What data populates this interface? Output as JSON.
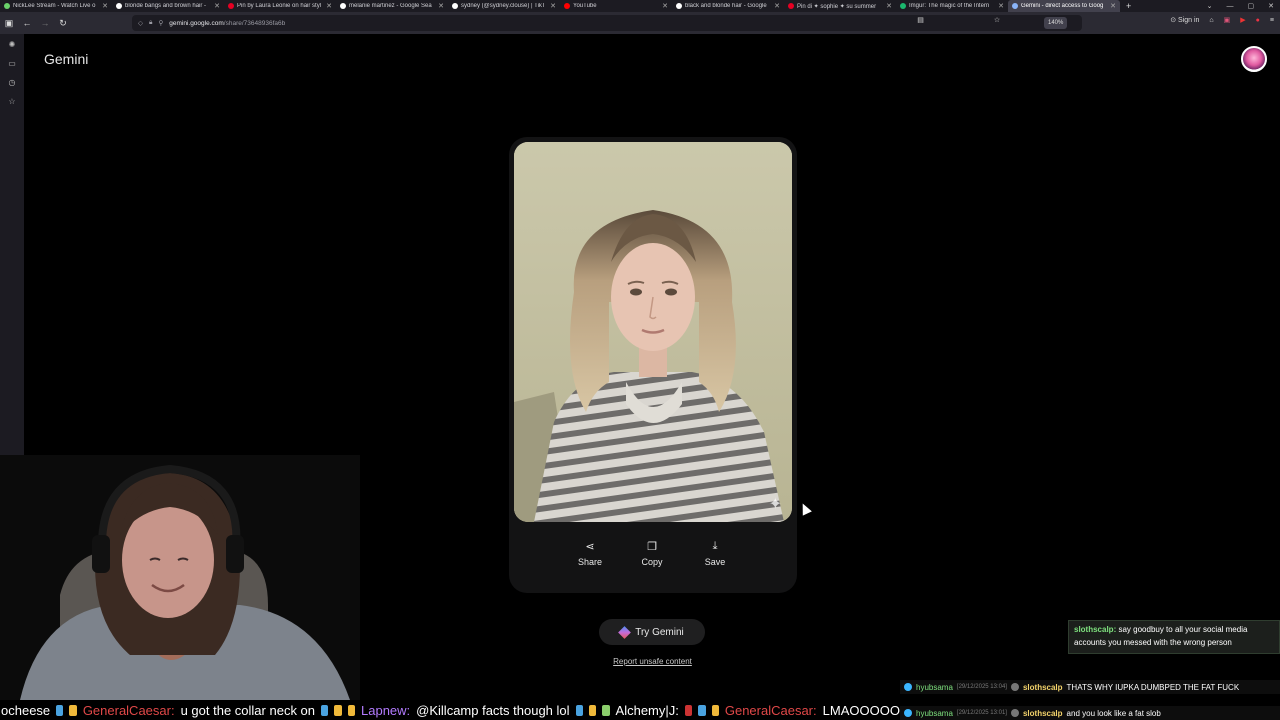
{
  "browser": {
    "tabs": [
      {
        "title": "NickLee Stream - Watch Live o",
        "favicon_color": "#6ad16a"
      },
      {
        "title": "blonde bangs and brown hair -",
        "favicon_color": "#ffffff"
      },
      {
        "title": "Pin by Laura Leonie on hair styl",
        "favicon_color": "#e60023"
      },
      {
        "title": "melanie martinez - Google Sea",
        "favicon_color": "#ffffff"
      },
      {
        "title": "sydney (@sydney.clouse) | TikT",
        "favicon_color": "#ffffff"
      },
      {
        "title": "YouTube",
        "favicon_color": "#ff0000"
      },
      {
        "title": "black and blonde hair - Google",
        "favicon_color": "#ffffff"
      },
      {
        "title": "Pin di ✦ sophie ✦ su summer",
        "favicon_color": "#e60023"
      },
      {
        "title": "Imgur: The magic of the Intern",
        "favicon_color": "#1bb76e"
      },
      {
        "title": "Gemini - direct access to Goog",
        "favicon_color": "#8ab4f8"
      }
    ],
    "url_domain": "gemini.google.com",
    "url_path": "/share/73648936fa6b",
    "zoom": "140%",
    "sign_in": "Sign in"
  },
  "gemini": {
    "title": "Gemini",
    "actions": {
      "share": "Share",
      "copy": "Copy",
      "save": "Save"
    },
    "try_label": "Try Gemini",
    "report_label": "Report unsafe content"
  },
  "chat": {
    "popup": {
      "user": "slothscalp:",
      "message": "say goodbuy to all your social media accounts you messed with the wrong person"
    },
    "lines": [
      {
        "user1": "hyubsama",
        "timestamp": "[29/12/2025 13:04]",
        "user2": "slothscalp",
        "message": "THATS WHY IUPKA DUMBPED THE FAT FUCK"
      },
      {
        "user1": "hyubsama",
        "timestamp": "[29/12/2025 13:01]",
        "user2": "slothscalp",
        "message": "and you look like a fat slob"
      }
    ]
  },
  "ticker": {
    "t1": "ocheese",
    "u1": "GeneralCaesar:",
    "m1": "u got the collar neck on",
    "u2": "Lapnew:",
    "m2": "@Killcamp facts though lol",
    "u3": "Alchemy|J:",
    "u4": "GeneralCaesar:",
    "m4": "LMAOOOOO"
  },
  "colors": {
    "background": "#000000",
    "card": "#131314",
    "chat_green": "#7ee07e",
    "chat_yellow": "#f3d36b",
    "ticker_red": "#e04848",
    "ticker_purple": "#b37bff"
  }
}
